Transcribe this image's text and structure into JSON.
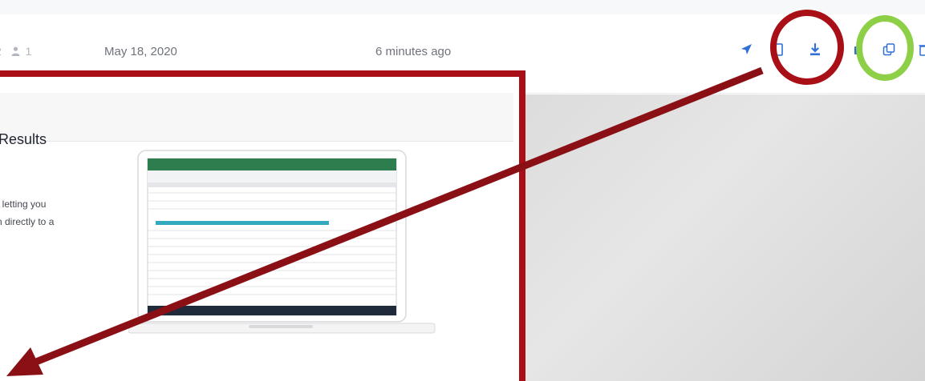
{
  "row": {
    "count_partial": "2",
    "user_count": "1",
    "date": "May 18, 2020",
    "relative_time": "6 minutes ago"
  },
  "card": {
    "title_partial": "Results",
    "description_line1": ", letting you",
    "description_line2": "n directly to a"
  },
  "icons": {
    "user": "user-icon",
    "send": "send-icon",
    "file": "file-icon",
    "download": "download-icon",
    "copy": "copy-icon",
    "delete": "trash-icon"
  },
  "colors": {
    "action_blue": "#2f6fd6",
    "red_annotation": "#a80f16",
    "green_annotation": "#8dd048"
  }
}
